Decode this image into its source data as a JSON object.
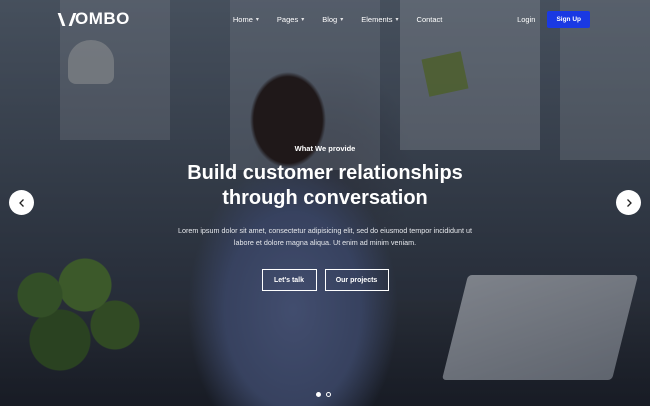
{
  "brand": {
    "logo_text": "OMBO"
  },
  "nav": {
    "items": [
      {
        "label": "Home",
        "caret": "▾"
      },
      {
        "label": "Pages",
        "caret": "▾"
      },
      {
        "label": "Blog",
        "caret": "▾"
      },
      {
        "label": "Elements",
        "caret": "▾"
      },
      {
        "label": "Contact",
        "caret": ""
      }
    ],
    "login_label": "Login",
    "signup_label": "Sign Up"
  },
  "hero": {
    "eyebrow": "What We provide",
    "title": "Build customer relationships through conversation",
    "description": "Lorem ipsum dolor sit amet, consectetur adipisicing elit, sed do eiusmod tempor incididunt ut labore et dolore magna aliqua. Ut enim ad minim veniam.",
    "primary_cta": "Let's talk",
    "secondary_cta": "Our projects"
  },
  "slider": {
    "prev_icon": "chevron-left-icon",
    "next_icon": "chevron-right-icon",
    "dot_count": 2,
    "active_index": 0
  },
  "colors": {
    "accent": "#1a39e3",
    "text": "#ffffff"
  }
}
